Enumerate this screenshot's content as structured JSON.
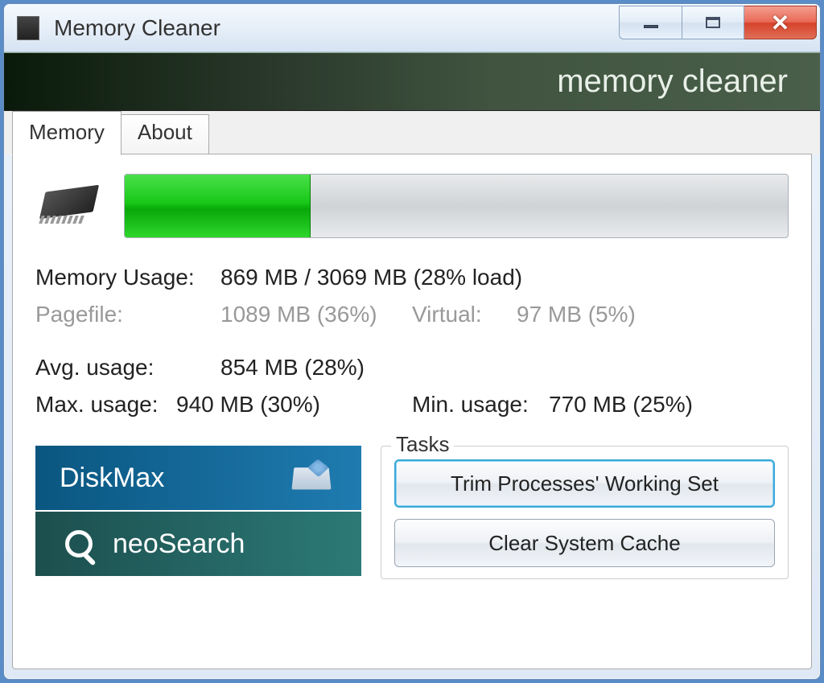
{
  "window": {
    "title": "Memory Cleaner",
    "banner": "memory cleaner"
  },
  "tabs": {
    "memory": "Memory",
    "about": "About"
  },
  "memory": {
    "progress_percent": 28,
    "usage_label": "Memory Usage:",
    "usage_value": "869 MB / 3069 MB  (28% load)",
    "pagefile_label": "Pagefile:",
    "pagefile_value": "1089 MB (36%)",
    "virtual_label": "Virtual:",
    "virtual_value": "97 MB (5%)",
    "avg_label": "Avg. usage:",
    "avg_value": "854 MB (28%)",
    "max_label": "Max. usage:",
    "max_value": "940 MB (30%)",
    "min_label": "Min. usage:",
    "min_value": "770 MB (25%)"
  },
  "promo": {
    "diskmax": "DiskMax",
    "neosearch": "neoSearch"
  },
  "tasks": {
    "legend": "Tasks",
    "trim": "Trim Processes' Working Set",
    "clear": "Clear System Cache"
  }
}
